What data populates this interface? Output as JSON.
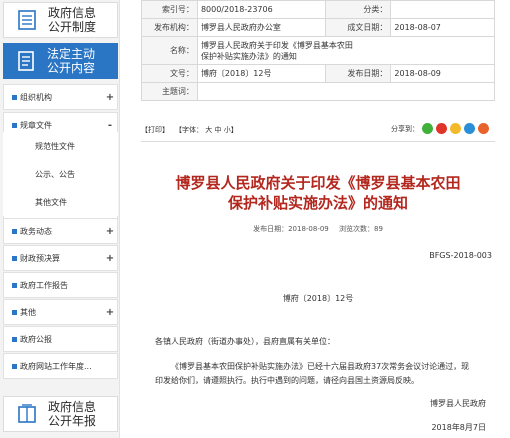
{
  "sidebar": {
    "top_card": {
      "line1": "政府信息",
      "line2": "公开制度"
    },
    "active_card": {
      "line1": "法定主动",
      "line2": "公开内容"
    },
    "menu": [
      {
        "label": "组织机构",
        "toggle": "+"
      },
      {
        "label": "规章文件",
        "toggle": "-"
      },
      {
        "label": "政务动态",
        "toggle": "+"
      },
      {
        "label": "财政预决算",
        "toggle": "+"
      },
      {
        "label": "政府工作报告",
        "toggle": ""
      },
      {
        "label": "其他",
        "toggle": "+"
      },
      {
        "label": "政府公报",
        "toggle": ""
      },
      {
        "label": "政府网站工作年度...",
        "toggle": ""
      }
    ],
    "submenu": [
      "规范性文件",
      "公示、公告",
      "其他文件"
    ],
    "bottom_card": {
      "line1": "政府信息",
      "line2": "公开年报"
    }
  },
  "info_table": {
    "index_label": "索引号：",
    "index_value": "8000/2018-23706",
    "category_label": "分类：",
    "category_value": "",
    "issuer_label": "发布机构：",
    "issuer_value": "博罗县人民政府办公室",
    "created_label": "成文日期：",
    "created_value": "2018-08-07",
    "name_label": "名称：",
    "name_value_line1": "博罗县人民政府关于印发《博罗县基本农田",
    "name_value_line2": "保护补贴实施办法》的通知",
    "docno_label": "文号：",
    "docno_value": "博府〔2018〕12号",
    "published_label": "发布日期：",
    "published_value": "2018-08-09",
    "topic_label": "主题词：",
    "topic_value": ""
  },
  "toolbar": {
    "print": "【打印】",
    "font": "【字体：",
    "font_large": "大",
    "font_medium": "中",
    "font_small": "小】",
    "share_label": "分享到：",
    "share_icons": [
      {
        "name": "wechat-icon",
        "color": "#3fb13a"
      },
      {
        "name": "weibo-icon",
        "color": "#e0342b"
      },
      {
        "name": "qzone-icon",
        "color": "#f2b92a"
      },
      {
        "name": "qq-icon",
        "color": "#2a8fd8"
      },
      {
        "name": "more-share-icon",
        "color": "#e8622c"
      }
    ]
  },
  "document": {
    "title_line1": "博罗县人民政府关于印发《博罗县基本农田",
    "title_line2": "保护补贴实施办法》的通知",
    "published": "发布日期：2018-08-09",
    "views": "浏览次数：89",
    "code": "BFGS-2018-003",
    "issue_no": "博府〔2018〕12号",
    "addressee": "各镇人民政府（街道办事处），县府直属有关单位：",
    "body": "《博罗县基本农田保护补贴实施办法》已经十六届县政府37次常务会议讨论通过，现印发给你们，请遵照执行。执行中遇到的问题，请径向县国土资源局反映。",
    "signature": "博罗县人民政府",
    "date": "2018年8月7日"
  },
  "colors": {
    "accent": "#2a75c4",
    "title_red": "#b3271e"
  }
}
